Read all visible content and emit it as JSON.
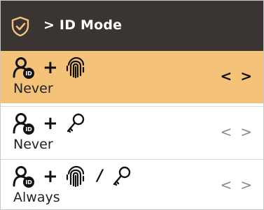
{
  "header": {
    "title": "> ID Mode",
    "icon": "shield-check-icon",
    "background": "#3a3432",
    "accent": "#f5c27a"
  },
  "options": [
    {
      "label": "Never",
      "icons": [
        "id-card-user-icon",
        "fingerprint-icon"
      ],
      "selected": true
    },
    {
      "label": "Never",
      "icons": [
        "id-card-user-icon",
        "key-icon"
      ],
      "selected": false
    },
    {
      "label": "Always",
      "icons": [
        "id-card-user-icon",
        "fingerprint-icon",
        "key-icon"
      ],
      "selected": false
    }
  ],
  "arrows": {
    "prev": "<",
    "next": ">"
  },
  "symbols": {
    "plus": "+",
    "or": "/"
  }
}
